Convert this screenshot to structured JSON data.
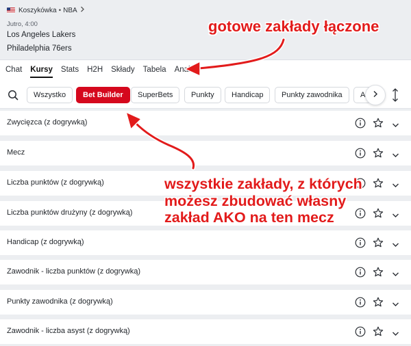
{
  "header": {
    "sport": "Koszykówka",
    "separator": "•",
    "league": "NBA",
    "date": "Jutro, 4:00",
    "home_team": "Los Angeles Lakers",
    "away_team": "Philadelphia 76ers"
  },
  "tabs": [
    {
      "label": "Chat",
      "active": false
    },
    {
      "label": "Kursy",
      "active": true
    },
    {
      "label": "Stats",
      "active": false
    },
    {
      "label": "H2H",
      "active": false
    },
    {
      "label": "Składy",
      "active": false
    },
    {
      "label": "Tabela",
      "active": false
    },
    {
      "label": "Analizy",
      "active": false
    }
  ],
  "filters": [
    {
      "label": "Wszystko",
      "active": false
    },
    {
      "label": "Bet Builder",
      "active": true
    },
    {
      "label": "SuperBets",
      "active": false
    },
    {
      "label": "Punkty",
      "active": false
    },
    {
      "label": "Handicap",
      "active": false
    },
    {
      "label": "Punkty zawodnika",
      "active": false
    },
    {
      "label": "A",
      "active": false
    }
  ],
  "markets": [
    "Zwycięzca (z dogrywką)",
    "Mecz",
    "Liczba punktów (z dogrywką)",
    "Liczba punktów drużyny (z dogrywką)",
    "Handicap (z dogrywką)",
    "Zawodnik - liczba punktów (z dogrywką)",
    "Punkty zawodnika (z dogrywką)",
    "Zawodnik - liczba asyst (z dogrywką)"
  ],
  "annotations": {
    "top": "gotowe zakłady łączone",
    "line1": "wszystkie zakłady, z których",
    "line2": "możesz zbudować własny",
    "line3": "zakład AKO na ten mecz"
  },
  "colors": {
    "accent": "#d5081d",
    "annotation": "#e21b1b",
    "background": "#eceef1"
  },
  "icons": {
    "search": "search-icon",
    "scroll": "chevron-right-icon",
    "sort": "sort-arrows-icon",
    "info": "info-icon",
    "favorite": "star-icon",
    "expand": "chevron-down-icon",
    "flag": "us-flag-icon"
  }
}
